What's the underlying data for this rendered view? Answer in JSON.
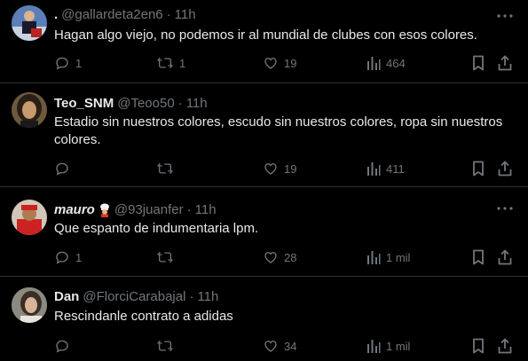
{
  "tweets": [
    {
      "name": ".",
      "handle": "@gallardeta2en6",
      "separator": "·",
      "time": "11h",
      "text": "Hagan algo viejo, no podemos ir al mundial de clubes con esos colores.",
      "replies": "1",
      "retweets": "1",
      "likes": "19",
      "views": "464"
    },
    {
      "name": "Teo_SNM",
      "handle": "@Teoo50",
      "separator": "·",
      "time": "11h",
      "text": "Estadio sin nuestros colores, escudo sin nuestros colores, ropa sin nuestros colores.",
      "replies": "",
      "retweets": "",
      "likes": "19",
      "views": "411"
    },
    {
      "name": "mauro",
      "handle": "@93juanfer",
      "separator": "·",
      "time": "11h",
      "text": "Que espanto de indumentaria lpm.",
      "replies": "1",
      "retweets": "",
      "likes": "28",
      "views": "1 mil"
    },
    {
      "name": "Dan",
      "handle": "@FlorciCarabajal",
      "separator": "·",
      "time": "11h",
      "text": "Rescindanle contrato a adidas",
      "replies": "",
      "retweets": "",
      "likes": "34",
      "views": "1 mil"
    }
  ],
  "icons": {
    "more": "more-horizontal-icon",
    "reply": "reply-icon",
    "retweet": "retweet-icon",
    "like": "heart-icon",
    "views": "views-chart-icon",
    "bookmark": "bookmark-icon",
    "share": "share-icon"
  },
  "colors": {
    "background": "#000000",
    "text": "#e7e9ea",
    "muted": "#71767b",
    "divider": "#2f3336"
  }
}
